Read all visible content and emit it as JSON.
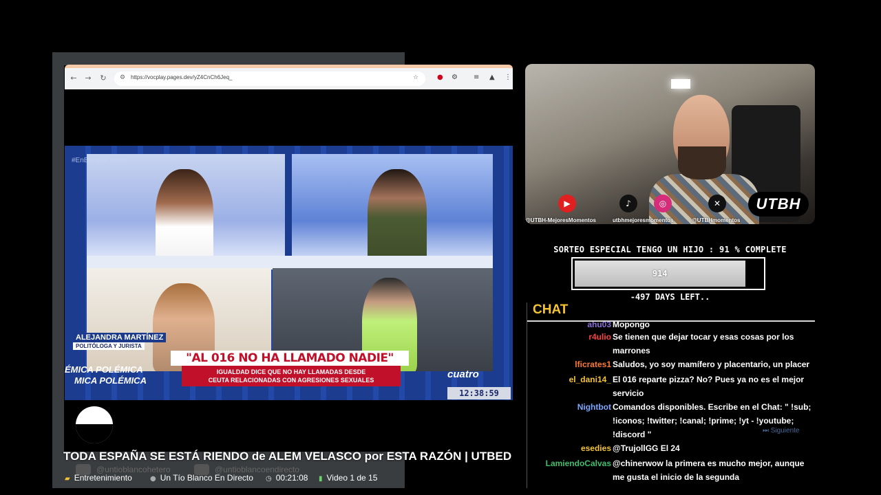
{
  "browser": {
    "url": "https://vocplay.pages.dev/yZ4CnCh6Jeq_",
    "back_icon": "arrow-left-icon",
    "forward_icon": "arrow-right-icon",
    "reload_icon": "reload-icon"
  },
  "broadcast": {
    "hashtag": "#EnBocaDeTodos",
    "guest_name": "ALEJANDRA MARTÍNEZ",
    "guest_role": "POLITÓLOGA Y JURISTA",
    "headline": "\"AL 016 NO HA LLAMADO NADIE\"",
    "sub_headline_1": "IGUALDAD DICE QUE NO HAY LLAMADAS DESDE",
    "sub_headline_2": "CEUTA RELACIONADAS CON AGRESIONES SEXUALES",
    "ticker_1": "ÉMICA   POLÉMICA",
    "ticker_2": "MICA   POLÉMICA",
    "channel": "cuatro",
    "clock": "12:38:59"
  },
  "webcam": {
    "socials": [
      {
        "icon": "youtube-icon",
        "glyph": "▶",
        "color": "#e02020"
      },
      {
        "icon": "tiktok-icon",
        "glyph": "♪",
        "color": "#111111"
      },
      {
        "icon": "instagram-icon",
        "glyph": "◎",
        "color": "#d62d7a"
      },
      {
        "icon": "x-icon",
        "glyph": "✕",
        "color": "#111111"
      }
    ],
    "label_youtube": "@UTBH-MejoresMomentos",
    "label_tiktok": "utbhmejoresmomentos",
    "label_x": "@UTBHmomentos",
    "logo": "UTBH"
  },
  "goal": {
    "title": "SORTEO ESPECIAL TENGO UN HIJO :  91 % COMPLETE",
    "value": "914",
    "progress": 0.91,
    "days_left": "-497 DAYS LEFT.."
  },
  "chat": {
    "title": "CHAT",
    "messages": [
      {
        "user": "ahu03",
        "text": "Mopongo",
        "color": "#8a6fd8"
      },
      {
        "user": "r4ulio",
        "text": "Se tienen que dejar tocar y esas cosas por los marrones",
        "color": "#ff4040"
      },
      {
        "user": "lficrates1",
        "text": "Saludos, yo soy mamífero y placentario, un placer",
        "color": "#ff7a2f"
      },
      {
        "user": "el_dani14_",
        "text": "El 016 reparte pizza? No? Pues ya no es el mejor servicio",
        "color": "#f5c431"
      },
      {
        "user": "Nightbot",
        "text": "Comandos disponibles. Escribe en el Chat: \" !sub; !iconos; !twitter; !canal; !prime; !yt - !youtube; !discord \"",
        "color": "#7aa7ff"
      },
      {
        "user": "esedies",
        "text": "@TrujollGG El 24",
        "color": "#f5c431"
      },
      {
        "user": "LamiendoCalvas",
        "text": "@chinerwow la primera es mucho mejor, aunque me gusta el inicio de la segunda",
        "color": "#3fbf6f"
      }
    ],
    "next_hint": "Siguiente"
  },
  "player": {
    "title": "TODA ESPAÑA SE ESTÁ RIENDO de ALEM VELASCO por ESTA RAZÓN | UTBED",
    "ghost_1": "@untioblancohetero",
    "ghost_2": "@untioblancoendirecto",
    "category": "Entretenimiento",
    "channel": "Un Tío Blanco En Directo",
    "duration": "00:21:08",
    "playlist": "Video 1 de 15"
  }
}
